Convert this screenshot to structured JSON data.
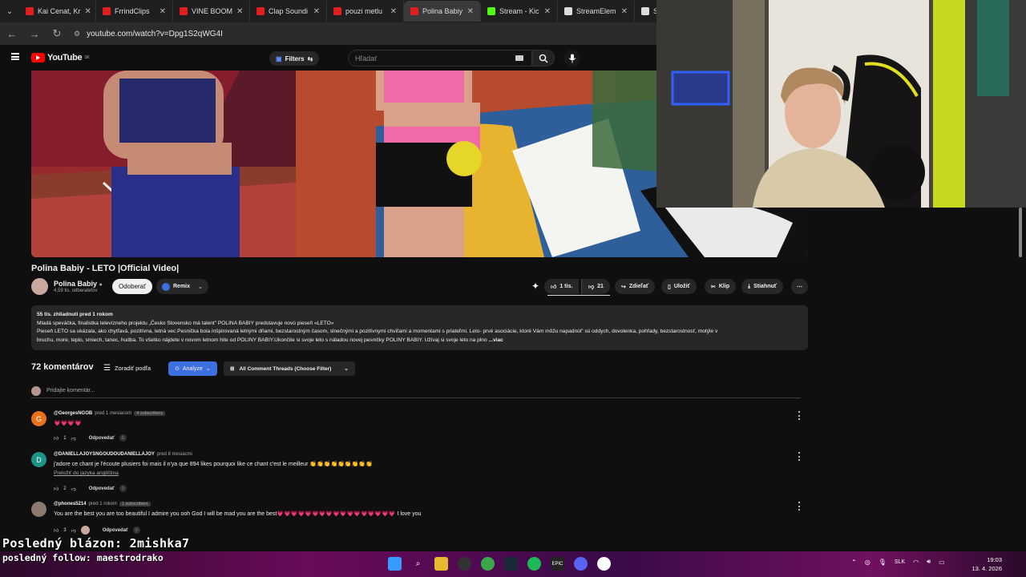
{
  "browser": {
    "tabs": [
      {
        "label": "Kai Cenat, Kr",
        "color": "#e02020"
      },
      {
        "label": "FrrindClips",
        "color": "#e02020"
      },
      {
        "label": "VINE BOOM",
        "color": "#e02020"
      },
      {
        "label": "Clap Soundi",
        "color": "#e02020"
      },
      {
        "label": "pouzi metlu",
        "color": "#e02020"
      },
      {
        "label": "Polina Babiy",
        "color": "#e02020"
      },
      {
        "label": "Stream - Kic",
        "color": "#53fc18"
      },
      {
        "label": "StreamElem",
        "color": "#dddddd"
      },
      {
        "label": "StreamEl",
        "color": "#dddddd"
      }
    ],
    "url": "youtube.com/watch?v=Dpg1S2qWG4I"
  },
  "header": {
    "logo_text": "YouTube",
    "region": "SK",
    "filters_label": "Filters",
    "search_placeholder": "Hľadať"
  },
  "video": {
    "title": "Polina Babiy - LETO |Official Video|",
    "channel": "Polina Babiy",
    "subscribers": "4,59 tis. odberateľov",
    "subscribe_label": "Odoberať",
    "remix_label": "Remix",
    "likes": "1 tis.",
    "dislikes": "21",
    "share_label": "Zdieľať",
    "save_label": "Uložiť",
    "clip_label": "Klip",
    "download_label": "Stiahnuť"
  },
  "description": {
    "meta": "55 tis. zhliadnutí  pred 1 rokom",
    "line1": "Mladá speváčka, finalistka televízneho projektu „Česko Slovensko má talent\" POLINA BABIY predstavuje novú pieseň «LETO»",
    "line2": "Pieseň LETO sa ukázala, ako chytľavá, pozitívna, letná vec.Pesnička bola inšpirovaná letnými dňami, bezstarostným časom, slnečnými a pozitívnymi chvíľami a momentami s priateľmi. Leto- prvé asociácie, ktoré Vám môžu napadnúť' sú oddych, dovolenka, pohľady, bezstarostnosť, motýle v",
    "line3": "bruchu, more, teplo, smiech, tanec, hudba. To všetko nájdete v novom letnom hite od POLINY BABIY.Ukončite si svoje leto s náladou novej pesničky POLINY BABIY. Užívaj si svoje leto na plno",
    "more": "...viac"
  },
  "comments": {
    "count": "72 komentárov",
    "sort_label": "Zoradiť podľa",
    "analyze_label": "Analyze",
    "threads_label": "All Comment Threads (Choose Filter)",
    "add_placeholder": "Pridajte komentár...",
    "reply_label": "Odpovedať",
    "items": [
      {
        "avatar": "G",
        "avatar_color": "#e8721c",
        "user": "@GeorgesNGOB",
        "time": "pred 1 mesiacom",
        "badge": "4 subscribers",
        "text": "💗💗💗💗",
        "likes": "1",
        "replies": "0"
      },
      {
        "avatar": "D",
        "avatar_color": "#1c9488",
        "user": "@DANIELLAJOYSNGOUDOUDANIELLAJOY",
        "time": "pred 8 mesiacmi",
        "badge": "",
        "text": "j'adore ce chant je l'écoute plusiers foi mais  il n'ya que 894 likes pourquoi like ce chant c'est le meilleur 👏👏👏👏👏👏👏👏👏",
        "translate": "Preložiť do jazyka angličtina",
        "likes": "2",
        "replies": "0"
      },
      {
        "avatar": "",
        "avatar_color": "#8a7a70",
        "user": "@phones5214",
        "time": "pred 1 rokom",
        "badge": "1 subscribers",
        "text": "You are the best you are too beautiful I admire you ooh God I will be mad you are the best💗💗💗💗💗💗💗💗💗💗💗💗💗💗💗💗💗 I love you",
        "likes": "3",
        "replies": "0"
      }
    ]
  },
  "stream_overlay": {
    "last_clown": "Posledný blázon: 2mishka7",
    "last_follow": "posledný follow: maestrodrako"
  },
  "system": {
    "lang": "SLK",
    "time": "19:03",
    "date": "13. 4. 2026"
  }
}
